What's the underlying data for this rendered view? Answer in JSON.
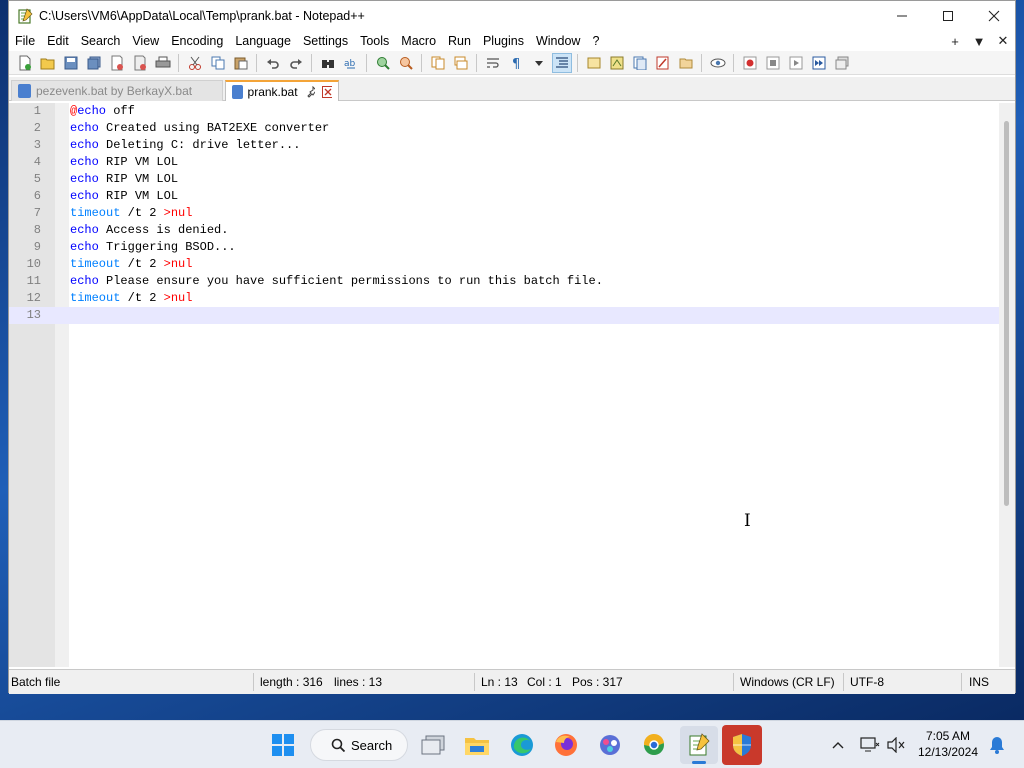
{
  "window": {
    "title": "C:\\Users\\VM6\\AppData\\Local\\Temp\\prank.bat - Notepad++",
    "minimize_icon": "minimize-icon",
    "maximize_icon": "maximize-icon",
    "close_icon": "close-icon"
  },
  "menubar": {
    "items": [
      "File",
      "Edit",
      "Search",
      "View",
      "Encoding",
      "Language",
      "Settings",
      "Tools",
      "Macro",
      "Run",
      "Plugins",
      "Window",
      "?"
    ],
    "right": [
      "+",
      "▼",
      "✕"
    ]
  },
  "toolbar": {
    "icons": [
      "new-file-icon",
      "open-file-icon",
      "save-icon",
      "save-all-icon",
      "close-icon",
      "close-all-icon",
      "print-icon",
      "cut-icon",
      "copy-icon",
      "paste-icon",
      "undo-icon",
      "redo-icon",
      "find-icon",
      "replace-icon",
      "zoom-in-icon",
      "zoom-out-icon",
      "sync-vertical-icon",
      "sync-horizontal-icon",
      "word-wrap-icon",
      "show-all-chars-icon",
      "indent-guide-icon",
      "udl-icon",
      "doc-map-icon",
      "function-list-icon",
      "folder-workspace-icon",
      "monitoring-icon",
      "record-macro-icon",
      "stop-macro-icon",
      "play-macro-icon",
      "run-macro-multiple-icon",
      "save-macro-icon"
    ]
  },
  "tabs": [
    {
      "label": "pezevenk.bat by BerkayX.bat",
      "active": false
    },
    {
      "label": "prank.bat",
      "active": true
    }
  ],
  "editor": {
    "lines": [
      {
        "num": "1",
        "parts": [
          {
            "t": "@",
            "c": "at"
          },
          {
            "t": "echo",
            "c": "kw"
          },
          {
            "t": " off",
            "c": ""
          }
        ]
      },
      {
        "num": "2",
        "parts": [
          {
            "t": "echo",
            "c": "kw"
          },
          {
            "t": " Created using BAT2EXE converter",
            "c": ""
          }
        ]
      },
      {
        "num": "3",
        "parts": [
          {
            "t": "echo",
            "c": "kw"
          },
          {
            "t": " Deleting C: drive letter...",
            "c": ""
          }
        ]
      },
      {
        "num": "4",
        "parts": [
          {
            "t": "echo",
            "c": "kw"
          },
          {
            "t": " RIP VM LOL",
            "c": ""
          }
        ]
      },
      {
        "num": "5",
        "parts": [
          {
            "t": "echo",
            "c": "kw"
          },
          {
            "t": " RIP VM LOL",
            "c": ""
          }
        ]
      },
      {
        "num": "6",
        "parts": [
          {
            "t": "echo",
            "c": "kw"
          },
          {
            "t": " RIP VM LOL",
            "c": ""
          }
        ]
      },
      {
        "num": "7",
        "parts": [
          {
            "t": "timeout",
            "c": "tmo"
          },
          {
            "t": " /t 2 ",
            "c": ""
          },
          {
            "t": ">nul",
            "c": "red"
          }
        ]
      },
      {
        "num": "8",
        "parts": [
          {
            "t": "echo",
            "c": "kw"
          },
          {
            "t": " Access is denied.",
            "c": ""
          }
        ]
      },
      {
        "num": "9",
        "parts": [
          {
            "t": "echo",
            "c": "kw"
          },
          {
            "t": " Triggering BSOD...",
            "c": ""
          }
        ]
      },
      {
        "num": "10",
        "parts": [
          {
            "t": "timeout",
            "c": "tmo"
          },
          {
            "t": " /t 2 ",
            "c": ""
          },
          {
            "t": ">nul",
            "c": "red"
          }
        ]
      },
      {
        "num": "11",
        "parts": [
          {
            "t": "echo",
            "c": "kw"
          },
          {
            "t": " Please ensure you have sufficient permissions to run this batch file.",
            "c": ""
          }
        ]
      },
      {
        "num": "12",
        "parts": [
          {
            "t": "timeout",
            "c": "tmo"
          },
          {
            "t": " /t 2 ",
            "c": ""
          },
          {
            "t": ">nul",
            "c": "red"
          }
        ]
      },
      {
        "num": "13",
        "parts": []
      }
    ],
    "current_line": 13
  },
  "statusbar": {
    "file_type": "Batch file",
    "length": "length : 316",
    "lines": "lines : 13",
    "ln": "Ln : 13",
    "col": "Col : 1",
    "pos": "Pos : 317",
    "eol": "Windows (CR LF)",
    "encoding": "UTF-8",
    "mode": "INS"
  },
  "taskbar": {
    "search_label": "Search",
    "time": "7:05 AM",
    "date": "12/13/2024",
    "apps": [
      "start-icon",
      "task-view-icon",
      "file-explorer-icon",
      "edge-icon",
      "firefox-icon",
      "app-icon",
      "chrome-like-icon",
      "notepadpp-icon",
      "security-shield-icon"
    ]
  },
  "colors": {
    "keyword": "#0000ff",
    "timeout": "#0080ff",
    "at_sign": "#ff0000",
    "redirect": "#ff0000",
    "active_tab_accent": "#f4a438",
    "current_line_bg": "#e8e8ff"
  }
}
